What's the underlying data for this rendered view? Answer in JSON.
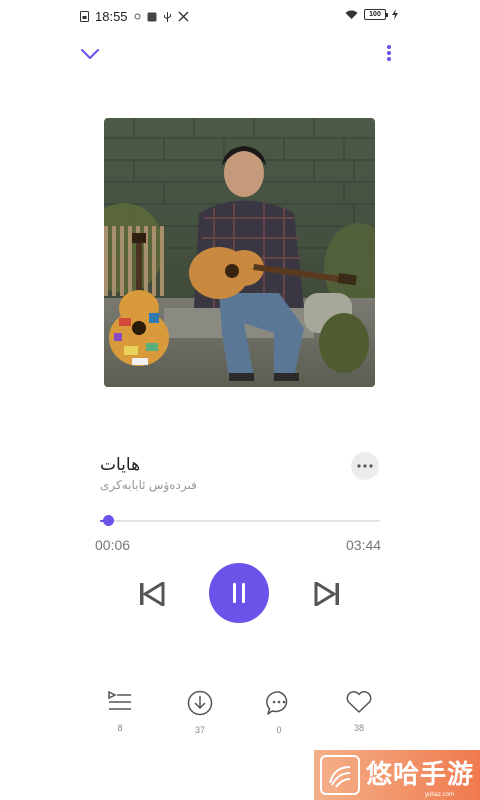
{
  "status_bar": {
    "time": "18:55",
    "battery_level": "100"
  },
  "song": {
    "title": "ھايات",
    "artist": "فىردەۋس ئابابەكرى"
  },
  "progress": {
    "elapsed": "00:06",
    "total": "03:44",
    "fraction": 0.027
  },
  "actions": {
    "playlist_count": "8",
    "download_count": "37",
    "comments_count": "0",
    "likes_count": "38"
  },
  "watermark": {
    "brand": "悠哈手游",
    "url": "yuhaz.com"
  },
  "colors": {
    "accent": "#6b52e8",
    "icon": "#555555"
  }
}
